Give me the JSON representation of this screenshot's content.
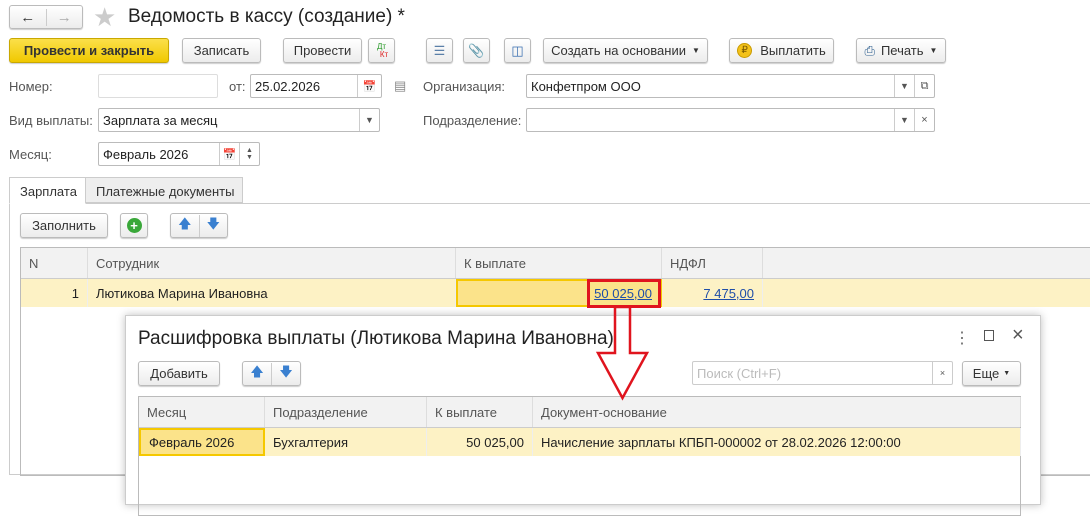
{
  "window": {
    "title": "Ведомость в кассу (создание) *"
  },
  "toolbar": {
    "post_close": "Провести и закрыть",
    "save": "Записать",
    "post": "Провести",
    "dt": "Дт",
    "kt": "Кт",
    "create_based": "Создать на основании",
    "pay": "Выплатить",
    "print": "Печать"
  },
  "form": {
    "number_label": "Номер:",
    "number_value": "",
    "date_label": "от:",
    "date_value": "25.02.2026",
    "org_label": "Организация:",
    "org_value": "Конфетпром ООО",
    "pay_type_label": "Вид выплаты:",
    "pay_type_value": "Зарплата за месяц",
    "dept_label": "Подразделение:",
    "dept_value": "",
    "month_label": "Месяц:",
    "month_value": "Февраль 2026"
  },
  "tabs": [
    {
      "label": "Зарплата"
    },
    {
      "label": "Платежные документы"
    }
  ],
  "table_toolbar": {
    "fill": "Заполнить"
  },
  "table": {
    "columns": [
      "N",
      "Сотрудник",
      "К выплате",
      "НДФЛ"
    ],
    "rows": [
      {
        "n": "1",
        "employee": "Лютикова Марина Ивановна",
        "to_pay": "50 025,00",
        "ndfl": "7 475,00"
      }
    ]
  },
  "dialog": {
    "title": "Расшифровка выплаты (Лютикова Марина Ивановна)",
    "add": "Добавить",
    "search_placeholder": "Поиск (Ctrl+F)",
    "more": "Еще",
    "columns": [
      "Месяц",
      "Подразделение",
      "К выплате",
      "Документ-основание"
    ],
    "rows": [
      {
        "month": "Февраль 2026",
        "dept": "Бухгалтерия",
        "to_pay": "50 025,00",
        "doc": "Начисление зарплаты КПБП-000002 от 28.02.2026 12:00:00"
      }
    ]
  },
  "colors": {
    "accent_yellow": "#f5d010",
    "row_highlight": "#fdf2c5",
    "annotation_red": "#e0141e",
    "link": "#1f4ea8"
  }
}
